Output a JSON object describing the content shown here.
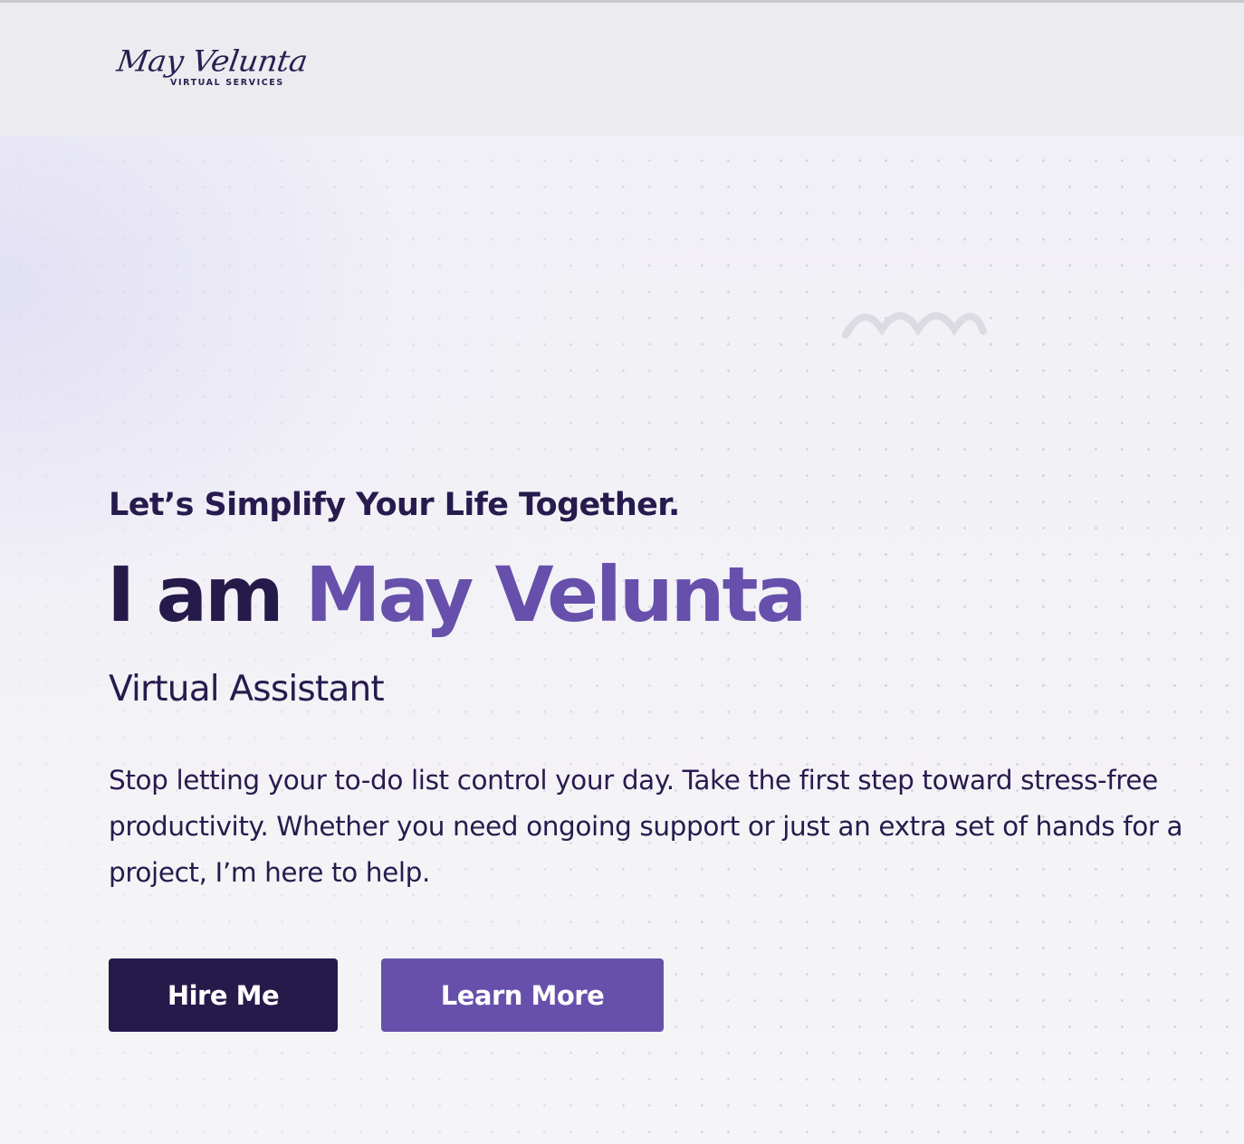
{
  "header": {
    "logo": {
      "script_text": "May Velunta",
      "subtitle": "VIRTUAL SERVICES"
    }
  },
  "hero": {
    "tagline": "Let’s Simplify Your Life Together.",
    "headline_prefix": "I am",
    "headline_name": "May Velunta",
    "role": "Virtual Assistant",
    "description": "Stop letting your to-do list control your day. Take the first step toward stress-free productivity. Whether you need ongoing support or just an extra set of hands for a project, I’m here to help.",
    "buttons": {
      "hire_label": "Hire Me",
      "learn_label": "Learn More"
    }
  },
  "colors": {
    "dark_navy": "#261a4b",
    "accent_purple": "#6750ab",
    "header_bg": "#ecebef",
    "decor_gray": "#dcdae2"
  },
  "icons": {
    "decoration": "squiggle-wave-icon"
  }
}
